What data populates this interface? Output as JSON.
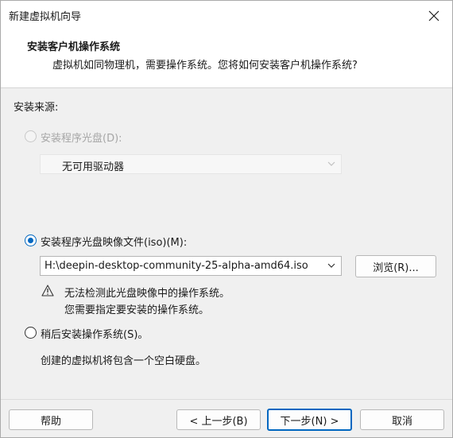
{
  "window": {
    "title": "新建虚拟机向导"
  },
  "header": {
    "title": "安装客户机操作系统",
    "subtitle": "虚拟机如同物理机，需要操作系统。您将如何安装客户机操作系统?"
  },
  "install_source": {
    "label": "安装来源:",
    "disc_option": {
      "label": "安装程序光盘(D):",
      "selected": false,
      "enabled": false,
      "drive_value": "无可用驱动器"
    },
    "iso_option": {
      "label": "安装程序光盘映像文件(iso)(M):",
      "selected": true,
      "enabled": true,
      "path_value": "H:\\deepin-desktop-community-25-alpha-amd64.iso",
      "browse_label": "浏览(R)...",
      "warning_line1": "无法检测此光盘映像中的操作系统。",
      "warning_line2": "您需要指定要安装的操作系统。"
    },
    "later_option": {
      "label": "稍后安装操作系统(S)。",
      "selected": false,
      "enabled": true,
      "description": "创建的虚拟机将包含一个空白硬盘。"
    }
  },
  "footer": {
    "help_label": "帮助",
    "back_label": "< 上一步(B)",
    "next_label": "下一步(N) >",
    "cancel_label": "取消"
  },
  "colors": {
    "accent": "#0067c0",
    "dialog_bg": "#f0f0f0",
    "header_bg": "#ffffff",
    "disabled_text": "#a6a6a6"
  }
}
